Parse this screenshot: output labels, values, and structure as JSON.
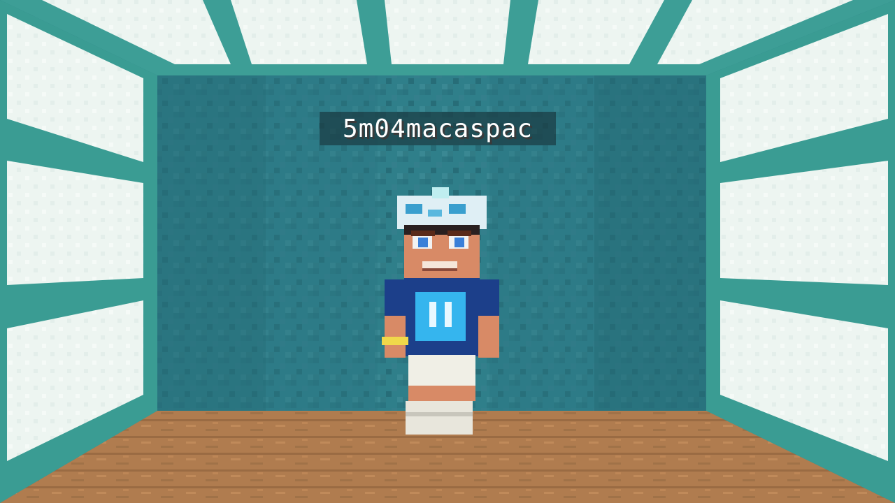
{
  "player": {
    "nametag": "5m04macaspac"
  },
  "scene": {
    "description_icons": [
      "prismarine-wall",
      "sea-lantern-frame",
      "oak-plank-floor",
      "player-character"
    ],
    "colors": {
      "wall": "#2f7f8a",
      "wall_dark": "#1f5f68",
      "frame": "#3fa59c",
      "lantern": "#eef6f2",
      "floor": "#b07c4f",
      "floor_dark": "#956540",
      "shirt": "#1c3f8a",
      "shirt_logo": "#35b5ee",
      "skin": "#d88a66",
      "shorts": "#f0efe6",
      "crown": "#dfeff5"
    }
  }
}
